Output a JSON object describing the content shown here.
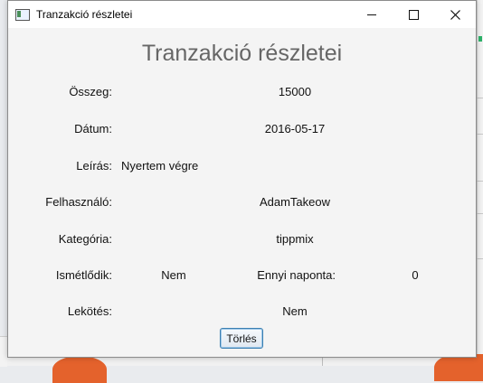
{
  "window": {
    "title": "Tranzakció részletei",
    "controls": [
      "minimize",
      "maximize",
      "close"
    ]
  },
  "heading": "Tranzakció részletei",
  "fields": {
    "osszeg": {
      "label": "Összeg:",
      "value": "15000"
    },
    "datum": {
      "label": "Dátum:",
      "value": "2016-05-17"
    },
    "leiras": {
      "label": "Leírás:",
      "value": "Nyertem végre"
    },
    "felhasznalo": {
      "label": "Felhasználó:",
      "value": "AdamTakeow"
    },
    "kategoria": {
      "label": "Kategória:",
      "value": "tippmix"
    },
    "ismetlodik": {
      "label": "Ismétlődik:",
      "value": "Nem"
    },
    "ennyi_naponta": {
      "label": "Ennyi naponta:",
      "value": "0"
    },
    "lekotes": {
      "label": "Lekötés:",
      "value": "Nem"
    }
  },
  "actions": {
    "delete_label": "Törlés"
  }
}
